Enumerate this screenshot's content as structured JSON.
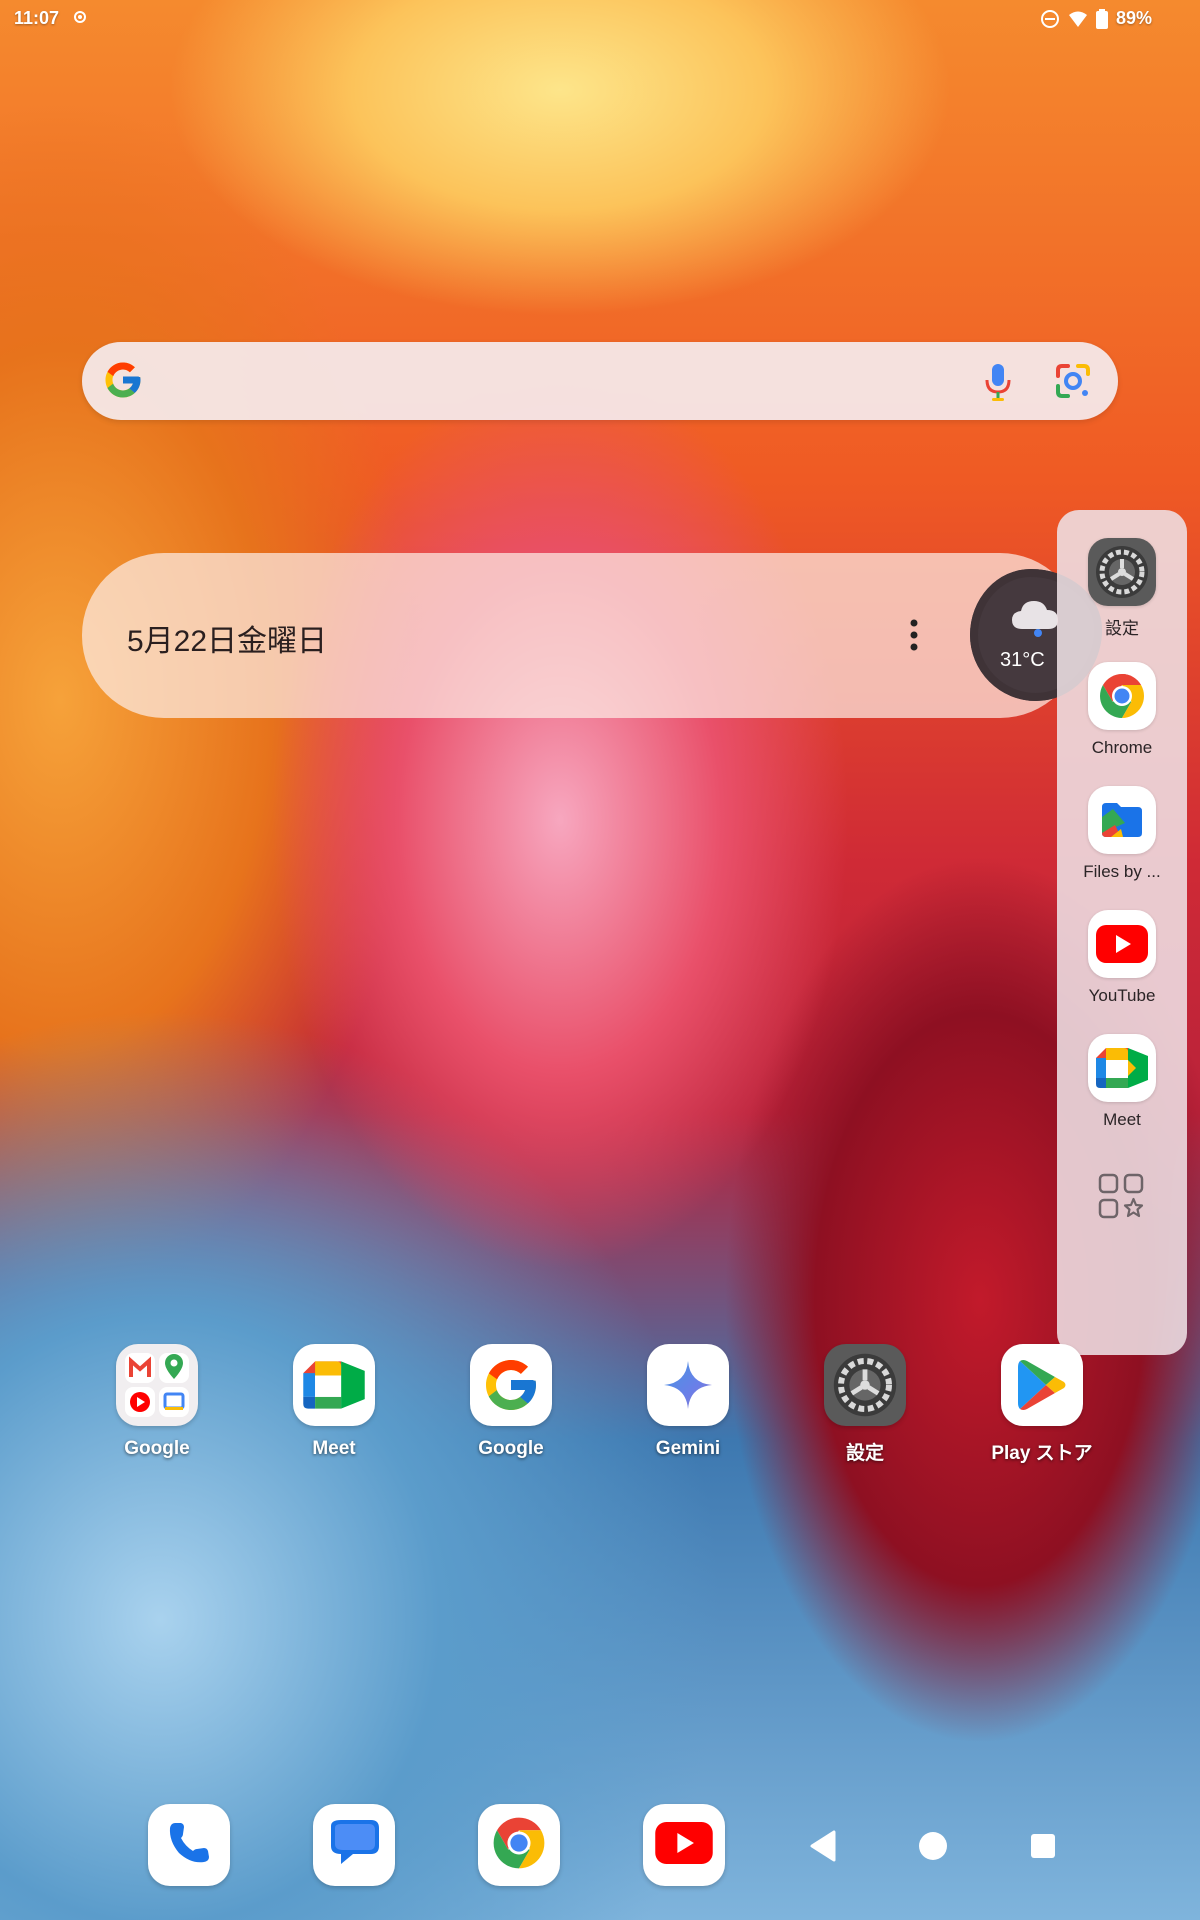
{
  "status_bar": {
    "time": "11:07",
    "battery": "89%"
  },
  "search": {
    "placeholder": ""
  },
  "date_widget": {
    "date": "5月22日金曜日",
    "temperature": "31°C"
  },
  "side_panel": {
    "apps": [
      {
        "label": "設定",
        "icon": "settings-icon"
      },
      {
        "label": "Chrome",
        "icon": "chrome-icon"
      },
      {
        "label": "Files by ...",
        "icon": "files-icon"
      },
      {
        "label": "YouTube",
        "icon": "youtube-icon"
      },
      {
        "label": "Meet",
        "icon": "meet-icon"
      }
    ]
  },
  "home_apps": [
    {
      "label": "Google",
      "icon": "google-folder-icon"
    },
    {
      "label": "Meet",
      "icon": "meet-icon"
    },
    {
      "label": "Google",
      "icon": "google-icon"
    },
    {
      "label": "Gemini",
      "icon": "gemini-icon"
    },
    {
      "label": "設定",
      "icon": "settings-icon"
    },
    {
      "label": "Play ストア",
      "icon": "play-store-icon"
    }
  ],
  "dock": [
    {
      "icon": "phone-icon"
    },
    {
      "icon": "messages-icon"
    },
    {
      "icon": "chrome-icon"
    },
    {
      "icon": "youtube-icon"
    }
  ],
  "colors": {
    "google_blue": "#4285F4",
    "google_red": "#EA4335",
    "google_yellow": "#FBBC05",
    "google_green": "#34A853",
    "youtube_red": "#FF0000"
  }
}
